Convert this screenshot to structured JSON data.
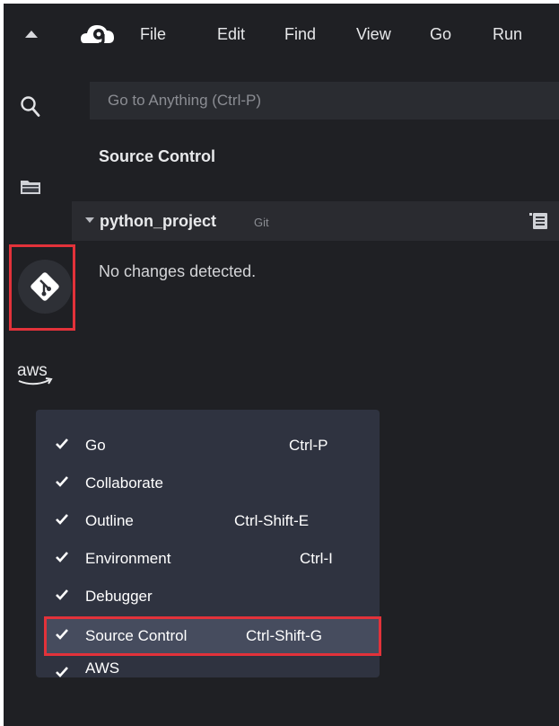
{
  "menubar": {
    "items": [
      "File",
      "Edit",
      "Find",
      "View",
      "Go",
      "Run"
    ]
  },
  "search": {
    "placeholder": "Go to Anything (Ctrl-P)"
  },
  "panel": {
    "title": "Source Control",
    "repo_name": "python_project",
    "repo_vcs": "Git",
    "status": "No changes detected."
  },
  "rail": {
    "icons": [
      "search-icon",
      "folder-icon",
      "git-icon",
      "aws-logo"
    ],
    "aws_text": "aws"
  },
  "context_menu": {
    "items": [
      {
        "label": "Go",
        "shortcut": "Ctrl-P",
        "checked": true
      },
      {
        "label": "Collaborate",
        "shortcut": "",
        "checked": true
      },
      {
        "label": "Outline",
        "shortcut": "Ctrl-Shift-E",
        "checked": true
      },
      {
        "label": "Environment",
        "shortcut": "Ctrl-I",
        "checked": true
      },
      {
        "label": "Debugger",
        "shortcut": "",
        "checked": true
      },
      {
        "label": "Source Control",
        "shortcut": "Ctrl-Shift-G",
        "checked": true,
        "highlighted": true
      },
      {
        "label": "AWS",
        "shortcut": "",
        "checked": true
      }
    ]
  },
  "colors": {
    "background": "#1f2024",
    "menu_background": "#2f3340",
    "highlight": "#464c5e",
    "annotation_red": "#e2323a"
  }
}
